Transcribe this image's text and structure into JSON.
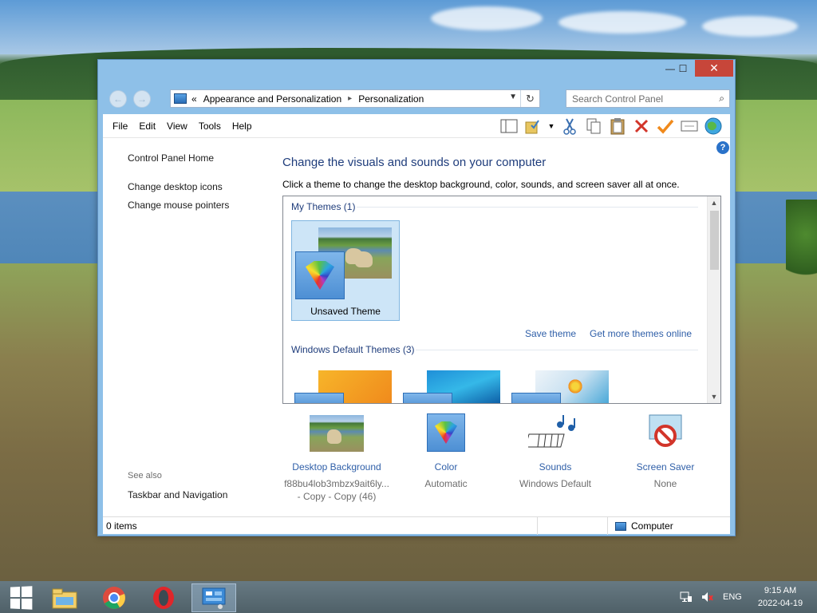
{
  "window": {
    "title_buttons": {
      "minimize": "—",
      "maximize": "☐",
      "close": "✕"
    },
    "address": {
      "prefix": "«",
      "crumbs": [
        "Appearance and Personalization",
        "Personalization"
      ]
    },
    "search": {
      "placeholder": "Search Control Panel"
    },
    "menu": [
      "File",
      "Edit",
      "View",
      "Tools",
      "Help"
    ],
    "toolbar_icons": [
      "layout-icon",
      "folder-check-icon",
      "dropdown-icon",
      "cut-icon",
      "copy-icon",
      "paste-icon",
      "delete-icon",
      "check-icon",
      "properties-icon",
      "globe-icon"
    ]
  },
  "leftpane": {
    "home": "Control Panel Home",
    "links": [
      "Change desktop icons",
      "Change mouse pointers"
    ],
    "see_also": "See also",
    "see_also_links": [
      "Taskbar and Navigation"
    ]
  },
  "content": {
    "heading": "Change the visuals and sounds on your computer",
    "subtext": "Click a theme to change the desktop background, color, sounds, and screen saver all at once.",
    "my_themes": "My Themes (1)",
    "unsaved_theme": "Unsaved Theme",
    "save_theme": "Save theme",
    "get_more": "Get more themes online",
    "windows_default": "Windows Default Themes (3)"
  },
  "bottom": {
    "desktop_background": {
      "label": "Desktop Background",
      "value": "f88bu4lob3mbzx9ait6ly...\n- Copy - Copy (46)"
    },
    "color": {
      "label": "Color",
      "value": "Automatic"
    },
    "sounds": {
      "label": "Sounds",
      "value": "Windows Default"
    },
    "screen_saver": {
      "label": "Screen Saver",
      "value": "None"
    }
  },
  "status": {
    "items": "0 items",
    "location": "Computer"
  },
  "taskbar": {
    "lang": "ENG",
    "time": "9:15 AM",
    "date": "2022-04-19"
  }
}
